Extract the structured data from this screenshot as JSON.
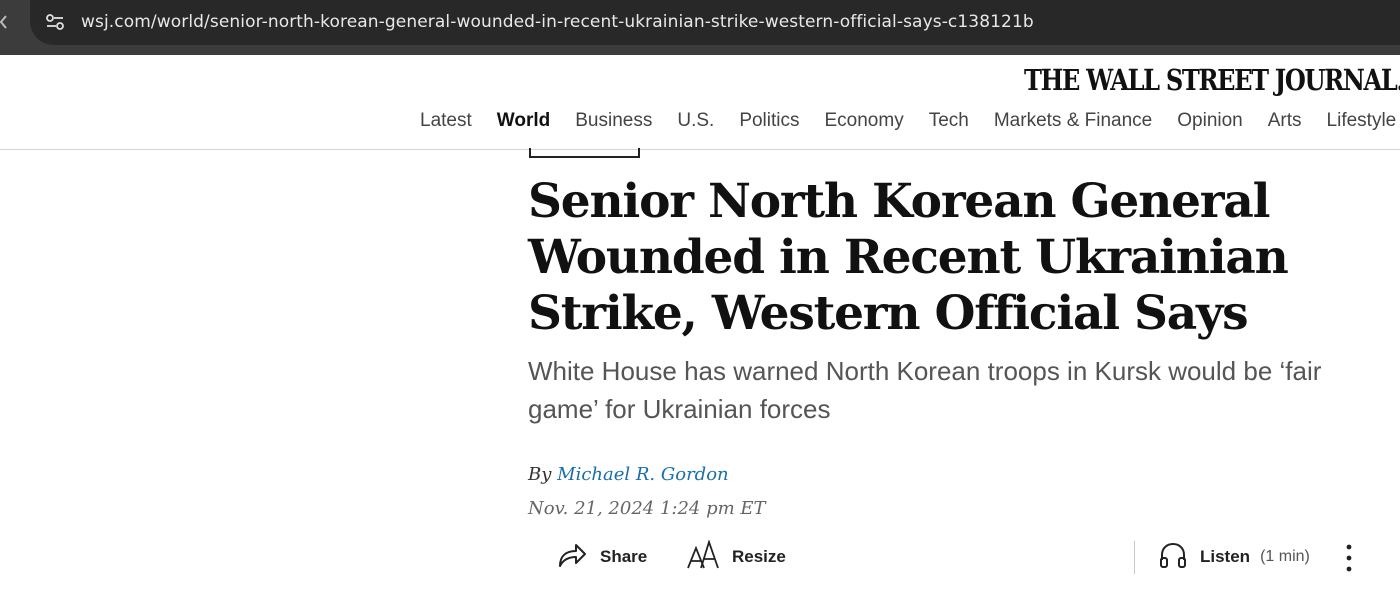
{
  "browser": {
    "url_domain": "wsj.com",
    "url_path": "/world/senior-north-korean-general-wounded-in-recent-ukrainian-strike-western-official-says-c138121b",
    "site_info_icon": "tune-icon"
  },
  "masthead": {
    "title": "THE WALL STREET JOURNAL."
  },
  "nav": {
    "items": [
      {
        "label": "Latest",
        "active": false
      },
      {
        "label": "World",
        "active": true
      },
      {
        "label": "Business",
        "active": false
      },
      {
        "label": "U.S.",
        "active": false
      },
      {
        "label": "Politics",
        "active": false
      },
      {
        "label": "Economy",
        "active": false
      },
      {
        "label": "Tech",
        "active": false
      },
      {
        "label": "Markets & Finance",
        "active": false
      },
      {
        "label": "Opinion",
        "active": false
      },
      {
        "label": "Arts",
        "active": false
      },
      {
        "label": "Lifestyle",
        "active": false
      }
    ]
  },
  "article": {
    "headline": "Senior North Korean General Wounded in Recent Ukrainian Strike, Western Official Says",
    "dek": "White House has warned North Korean troops in Kursk would be ‘fair game’ for Ukrainian forces",
    "byline_prefix": "By",
    "author": "Michael R. Gordon",
    "timestamp": "Nov. 21, 2024 1:24 pm ET"
  },
  "tools": {
    "share_label": "Share",
    "resize_label": "Resize",
    "listen_label": "Listen",
    "listen_duration": "(1 min)",
    "icons": {
      "share": "share-arrow-icon",
      "resize": "text-resize-icon",
      "listen": "headphones-icon",
      "more": "more-vertical-icon"
    }
  },
  "colors": {
    "browser_chrome": "#3c3c3c",
    "url_pill": "#282828",
    "author_link": "#1a6fa8",
    "headline": "#111111",
    "dek": "#555555"
  }
}
